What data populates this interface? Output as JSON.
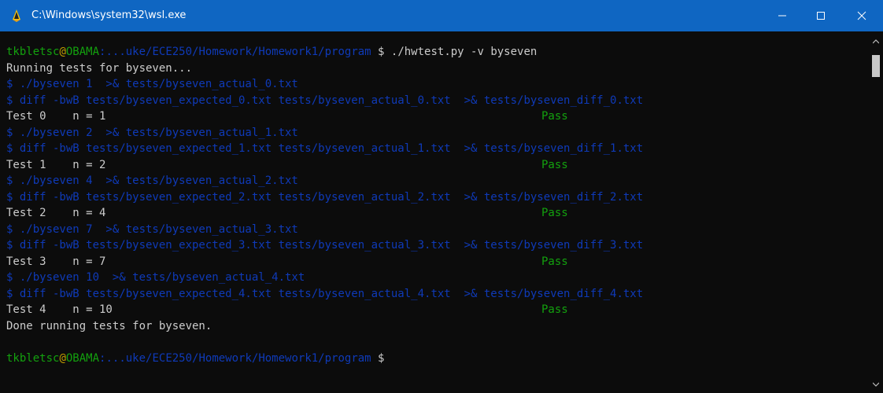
{
  "window": {
    "title": "C:\\Windows\\system32\\wsl.exe",
    "app_icon": "tux-penguin-icon",
    "controls": [
      "minimize-icon",
      "maximize-icon",
      "close-icon"
    ],
    "titlebar_color": "#0f66c2"
  },
  "prompt": {
    "user": "tkbletsc",
    "at": "@",
    "host": "OBAMA",
    "path": ":...uke/ECE250/Homework/Homework1/program",
    "symbol": " $",
    "command": " ./hwtest.py -v byseven"
  },
  "output": {
    "running": "Running tests for byseven...",
    "done": "Done running tests for byseven."
  },
  "tests": [
    {
      "run_cmd": "$ ./byseven 1  >& tests/byseven_actual_0.txt",
      "diff_cmd": "$ diff -bwB tests/byseven_expected_0.txt tests/byseven_actual_0.txt  >& tests/byseven_diff_0.txt",
      "label": "Test 0    n = 1",
      "result": "Pass"
    },
    {
      "run_cmd": "$ ./byseven 2  >& tests/byseven_actual_1.txt",
      "diff_cmd": "$ diff -bwB tests/byseven_expected_1.txt tests/byseven_actual_1.txt  >& tests/byseven_diff_1.txt",
      "label": "Test 1    n = 2",
      "result": "Pass"
    },
    {
      "run_cmd": "$ ./byseven 4  >& tests/byseven_actual_2.txt",
      "diff_cmd": "$ diff -bwB tests/byseven_expected_2.txt tests/byseven_actual_2.txt  >& tests/byseven_diff_2.txt",
      "label": "Test 2    n = 4",
      "result": "Pass"
    },
    {
      "run_cmd": "$ ./byseven 7  >& tests/byseven_actual_3.txt",
      "diff_cmd": "$ diff -bwB tests/byseven_expected_3.txt tests/byseven_actual_3.txt  >& tests/byseven_diff_3.txt",
      "label": "Test 3    n = 7",
      "result": "Pass"
    },
    {
      "run_cmd": "$ ./byseven 10  >& tests/byseven_actual_4.txt",
      "diff_cmd": "$ diff -bwB tests/byseven_expected_4.txt tests/byseven_actual_4.txt  >& tests/byseven_diff_4.txt",
      "label": "Test 4    n = 10",
      "result": "Pass"
    }
  ],
  "scrollbar": {
    "up_icon": "scroll-up-arrow-icon",
    "down_icon": "scroll-down-arrow-icon"
  },
  "colors": {
    "background": "#0c0c0c",
    "text": "#cccccc",
    "green": "#13a10e",
    "yellow": "#c19c00",
    "blue": "#0f3ab8"
  }
}
